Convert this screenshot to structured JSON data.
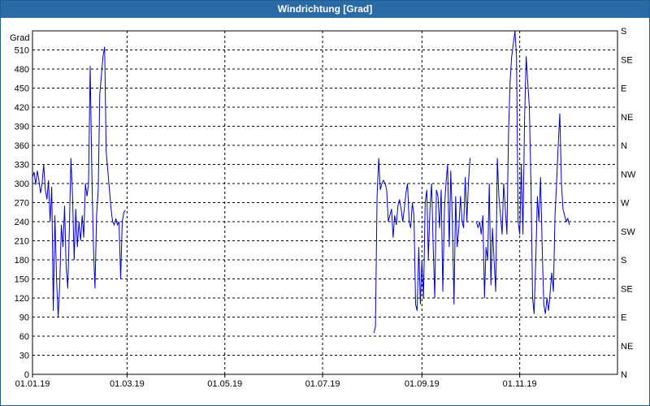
{
  "window": {
    "title": "Windrichtung [Grad]"
  },
  "colors": {
    "titlebar": "#2a6aa5",
    "series": "#0000c8",
    "grid": "#000000",
    "background": "#ffffff"
  },
  "chart_data": {
    "type": "line",
    "title": "Windrichtung [Grad]",
    "ylabel": "Grad",
    "xlabel": "",
    "ylim": [
      0,
      540
    ],
    "xlim": [
      "2019-01-01",
      "2019-12-31"
    ],
    "grid": true,
    "left_ticks": [
      "0",
      "30",
      "60",
      "90",
      "120",
      "150",
      "180",
      "210",
      "240",
      "270",
      "300",
      "330",
      "360",
      "390",
      "420",
      "450",
      "480",
      "510"
    ],
    "right_ticks": [
      "N",
      "NE",
      "E",
      "SE",
      "S",
      "SW",
      "W",
      "NW",
      "N",
      "NE",
      "E",
      "SE",
      "S"
    ],
    "x_tick_labels": [
      "01.01.19",
      "01.03.19",
      "01.05.19",
      "01.07.19",
      "01.09.19",
      "01.11.19"
    ],
    "series": [
      {
        "values": [
          [
            "2019-01-01",
            310
          ],
          [
            "2019-01-02",
            318
          ],
          [
            "2019-01-03",
            298
          ],
          [
            "2019-01-04",
            320
          ],
          [
            "2019-01-05",
            305
          ],
          [
            "2019-01-06",
            285
          ],
          [
            "2019-01-07",
            300
          ],
          [
            "2019-01-08",
            330
          ],
          [
            "2019-01-09",
            290
          ],
          [
            "2019-01-10",
            275
          ],
          [
            "2019-01-11",
            305
          ],
          [
            "2019-01-12",
            240
          ],
          [
            "2019-01-13",
            295
          ],
          [
            "2019-01-14",
            100
          ],
          [
            "2019-01-15",
            250
          ],
          [
            "2019-01-16",
            150
          ],
          [
            "2019-01-17",
            90
          ],
          [
            "2019-01-18",
            140
          ],
          [
            "2019-01-19",
            235
          ],
          [
            "2019-01-20",
            200
          ],
          [
            "2019-01-21",
            265
          ],
          [
            "2019-01-22",
            170
          ],
          [
            "2019-01-23",
            135
          ],
          [
            "2019-01-24",
            230
          ],
          [
            "2019-01-25",
            340
          ],
          [
            "2019-01-26",
            280
          ],
          [
            "2019-01-27",
            180
          ],
          [
            "2019-01-28",
            260
          ],
          [
            "2019-01-29",
            200
          ],
          [
            "2019-01-30",
            240
          ],
          [
            "2019-01-31",
            210
          ],
          [
            "2019-02-01",
            250
          ],
          [
            "2019-02-02",
            215
          ],
          [
            "2019-02-03",
            300
          ],
          [
            "2019-02-04",
            280
          ],
          [
            "2019-02-05",
            300
          ],
          [
            "2019-02-06",
            485
          ],
          [
            "2019-02-07",
            320
          ],
          [
            "2019-02-08",
            200
          ],
          [
            "2019-02-09",
            135
          ],
          [
            "2019-02-10",
            250
          ],
          [
            "2019-02-11",
            290
          ],
          [
            "2019-02-12",
            440
          ],
          [
            "2019-02-13",
            470
          ],
          [
            "2019-02-14",
            500
          ],
          [
            "2019-02-15",
            515
          ],
          [
            "2019-02-16",
            350
          ],
          [
            "2019-02-17",
            320
          ],
          [
            "2019-02-18",
            290
          ],
          [
            "2019-02-19",
            260
          ],
          [
            "2019-02-20",
            240
          ],
          [
            "2019-02-21",
            235
          ],
          [
            "2019-02-22",
            245
          ],
          [
            "2019-02-23",
            235
          ],
          [
            "2019-02-24",
            240
          ],
          [
            "2019-02-25",
            150
          ],
          [
            "2019-02-26",
            240
          ],
          [
            "2019-02-27",
            255
          ],
          [
            "2019-02-28",
            258
          ],
          null,
          [
            "2019-08-02",
            65
          ],
          [
            "2019-08-03",
            75
          ],
          [
            "2019-08-04",
            280
          ],
          [
            "2019-08-05",
            340
          ],
          [
            "2019-08-06",
            290
          ],
          [
            "2019-08-07",
            300
          ],
          [
            "2019-08-08",
            305
          ],
          [
            "2019-08-09",
            300
          ],
          [
            "2019-08-10",
            290
          ],
          [
            "2019-08-11",
            240
          ],
          [
            "2019-08-12",
            250
          ],
          [
            "2019-08-13",
            260
          ],
          [
            "2019-08-14",
            215
          ],
          [
            "2019-08-15",
            250
          ],
          [
            "2019-08-16",
            235
          ],
          [
            "2019-08-17",
            265
          ],
          [
            "2019-08-18",
            275
          ],
          [
            "2019-08-19",
            260
          ],
          [
            "2019-08-20",
            240
          ],
          [
            "2019-08-21",
            260
          ],
          [
            "2019-08-22",
            285
          ],
          [
            "2019-08-23",
            300
          ],
          [
            "2019-08-24",
            240
          ],
          [
            "2019-08-25",
            230
          ],
          [
            "2019-08-26",
            270
          ],
          [
            "2019-08-27",
            250
          ],
          [
            "2019-08-28",
            110
          ],
          [
            "2019-08-29",
            100
          ],
          [
            "2019-08-30",
            200
          ],
          [
            "2019-08-31",
            110
          ],
          [
            "2019-09-01",
            180
          ],
          [
            "2019-09-02",
            120
          ],
          [
            "2019-09-03",
            270
          ],
          [
            "2019-09-04",
            290
          ],
          [
            "2019-09-05",
            180
          ],
          [
            "2019-09-06",
            260
          ],
          [
            "2019-09-07",
            300
          ],
          [
            "2019-09-08",
            200
          ],
          [
            "2019-09-09",
            120
          ],
          [
            "2019-09-10",
            290
          ],
          [
            "2019-09-11",
            280
          ],
          [
            "2019-09-12",
            230
          ],
          [
            "2019-09-13",
            290
          ],
          [
            "2019-09-14",
            130
          ],
          [
            "2019-09-15",
            260
          ],
          [
            "2019-09-16",
            300
          ],
          [
            "2019-09-17",
            330
          ],
          [
            "2019-09-18",
            200
          ],
          [
            "2019-09-19",
            320
          ],
          [
            "2019-09-20",
            240
          ],
          [
            "2019-09-21",
            110
          ],
          [
            "2019-09-22",
            280
          ],
          [
            "2019-09-23",
            200
          ],
          [
            "2019-09-24",
            230
          ],
          [
            "2019-09-25",
            280
          ],
          [
            "2019-09-26",
            240
          ],
          [
            "2019-09-27",
            230
          ],
          [
            "2019-09-28",
            310
          ],
          [
            "2019-09-29",
            240
          ],
          [
            "2019-09-30",
            300
          ],
          [
            "2019-10-01",
            340
          ],
          null,
          [
            "2019-10-05",
            240
          ],
          [
            "2019-10-06",
            230
          ],
          [
            "2019-10-07",
            240
          ],
          [
            "2019-10-08",
            220
          ],
          [
            "2019-10-09",
            250
          ],
          [
            "2019-10-10",
            120
          ],
          [
            "2019-10-11",
            200
          ],
          [
            "2019-10-12",
            180
          ],
          [
            "2019-10-13",
            300
          ],
          [
            "2019-10-14",
            140
          ],
          [
            "2019-10-15",
            230
          ],
          [
            "2019-10-16",
            180
          ],
          [
            "2019-10-17",
            130
          ],
          [
            "2019-10-18",
            340
          ],
          [
            "2019-10-19",
            280
          ],
          [
            "2019-10-20",
            250
          ],
          [
            "2019-10-21",
            220
          ],
          [
            "2019-10-22",
            300
          ],
          [
            "2019-10-23",
            260
          ],
          [
            "2019-10-24",
            220
          ],
          [
            "2019-10-25",
            380
          ],
          [
            "2019-10-26",
            460
          ],
          [
            "2019-10-27",
            500
          ],
          [
            "2019-10-28",
            520
          ],
          [
            "2019-10-29",
            550
          ],
          [
            "2019-10-30",
            500
          ],
          [
            "2019-10-31",
            240
          ],
          [
            "2019-11-01",
            220
          ],
          [
            "2019-11-02",
            330
          ],
          [
            "2019-11-03",
            220
          ],
          [
            "2019-11-04",
            400
          ],
          [
            "2019-11-05",
            500
          ],
          [
            "2019-11-06",
            460
          ],
          [
            "2019-11-07",
            420
          ],
          [
            "2019-11-08",
            300
          ],
          [
            "2019-11-09",
            120
          ],
          [
            "2019-11-10",
            95
          ],
          [
            "2019-11-11",
            180
          ],
          [
            "2019-11-12",
            280
          ],
          [
            "2019-11-13",
            240
          ],
          [
            "2019-11-14",
            310
          ],
          [
            "2019-11-15",
            200
          ],
          [
            "2019-11-16",
            110
          ],
          [
            "2019-11-17",
            95
          ],
          [
            "2019-11-18",
            120
          ],
          [
            "2019-11-19",
            100
          ],
          [
            "2019-11-20",
            130
          ],
          [
            "2019-11-21",
            160
          ],
          [
            "2019-11-22",
            130
          ],
          [
            "2019-11-23",
            250
          ],
          [
            "2019-11-24",
            300
          ],
          [
            "2019-11-25",
            360
          ],
          [
            "2019-11-26",
            410
          ],
          [
            "2019-11-27",
            300
          ],
          [
            "2019-11-28",
            260
          ],
          [
            "2019-11-29",
            250
          ],
          [
            "2019-11-30",
            240
          ],
          [
            "2019-12-01",
            245
          ],
          [
            "2019-12-02",
            235
          ]
        ]
      }
    ]
  }
}
